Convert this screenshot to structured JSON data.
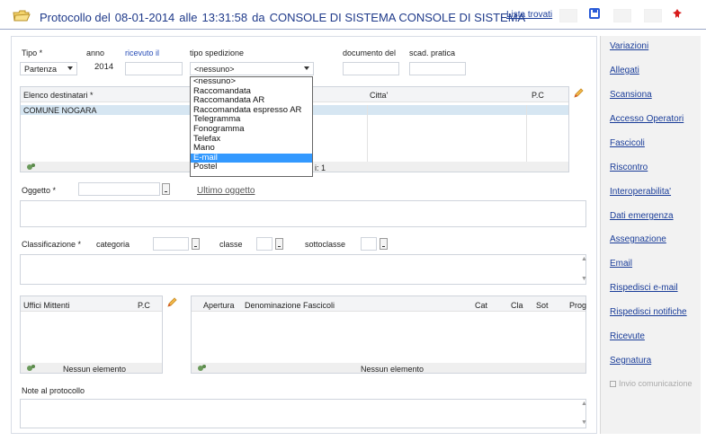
{
  "header": {
    "title_parts": [
      "Protocollo del",
      "08-01-2014",
      "alle",
      "13:31:58",
      "da",
      "CONSOLE DI SISTEMA CONSOLE DI SISTEMA"
    ],
    "lista_trovati": "Lista trovati",
    "icons": [
      "folder-icon",
      "save-icon",
      "close-red-icon"
    ]
  },
  "form": {
    "tipo_label": "Tipo *",
    "tipo_value": "Partenza",
    "anno_label": "anno",
    "anno_value": "2014",
    "ricevuto_label": "ricevuto il",
    "tipo_spedizione_label": "tipo spedizione",
    "tipo_spedizione_value": "<nessuno>",
    "documento_label": "documento del",
    "scad_label": "scad. pratica",
    "destinatari": {
      "col1": "Elenco destinatari *",
      "col2": "Citta'",
      "col3": "P.C",
      "rows": [
        "COMUNE NOGARA"
      ],
      "count_suffix": "i: 1"
    },
    "oggetto_label": "Oggetto *",
    "ultimo_oggetto": "Ultimo oggetto",
    "classificazione_label": "Classificazione *",
    "categoria_label": "categoria",
    "classe_label": "classe",
    "sottoclasse_label": "sottoclasse",
    "uffici": {
      "col1": "Uffici Mittenti",
      "col2": "P.C",
      "empty": "Nessun elemento"
    },
    "fascicoli": {
      "cols": [
        "Apertura",
        "Denominazione Fascicoli",
        "Cat",
        "Cla",
        "Sot",
        "Prog"
      ],
      "empty": "Nessun elemento"
    },
    "note_label": "Note al protocollo"
  },
  "dropdown_options": [
    "<nessuno>",
    "Raccomandata",
    "Raccomandata AR",
    "Raccomandata espresso AR",
    "Telegramma",
    "Fonogramma",
    "Telefax",
    "Mano",
    "E-mail",
    "Postel"
  ],
  "dropdown_highlighted": "E-mail",
  "sidebar": {
    "links": [
      "Variazioni",
      "Allegati",
      "Scansiona",
      "Accesso Operatori",
      "Fascicoli",
      "Riscontro",
      "Interoperabilita'",
      "Dati emergenza",
      "Assegnazione",
      "Email",
      "Rispedisci e-mail",
      "Rispedisci notifiche",
      "Ricevute",
      "Segnatura"
    ],
    "checkbox_label": "Invio comunicazione"
  },
  "colors": {
    "title": "#1f3a8a",
    "link": "#1a3d99",
    "selected_row": "#d6e6f2",
    "dropdown_highlight": "#3399ff"
  }
}
